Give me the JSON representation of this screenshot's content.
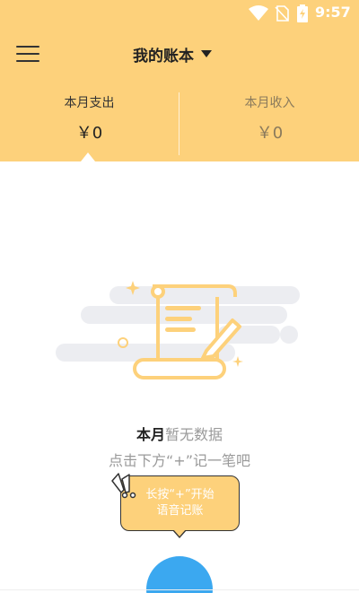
{
  "status_bar": {
    "time": "9:57"
  },
  "app_bar": {
    "book_title": "我的账本"
  },
  "summary": {
    "expense": {
      "label": "本月支出",
      "value": "￥0"
    },
    "income": {
      "label": "本月收入",
      "value": "￥0"
    }
  },
  "empty_state": {
    "title_bold": "本月",
    "title_rest": "暂无数据",
    "hint": "点击下方“+”记一笔吧"
  },
  "tooltip": {
    "line1": "长按“+”开始",
    "line2": "语音记账"
  },
  "colors": {
    "header_bg": "#FDD17B",
    "accent_blue": "#3BA8F0"
  },
  "icons": [
    "wifi-icon",
    "no-sim-icon",
    "battery-charging-icon",
    "menu-icon",
    "caret-down-icon",
    "exclaim-icon"
  ]
}
